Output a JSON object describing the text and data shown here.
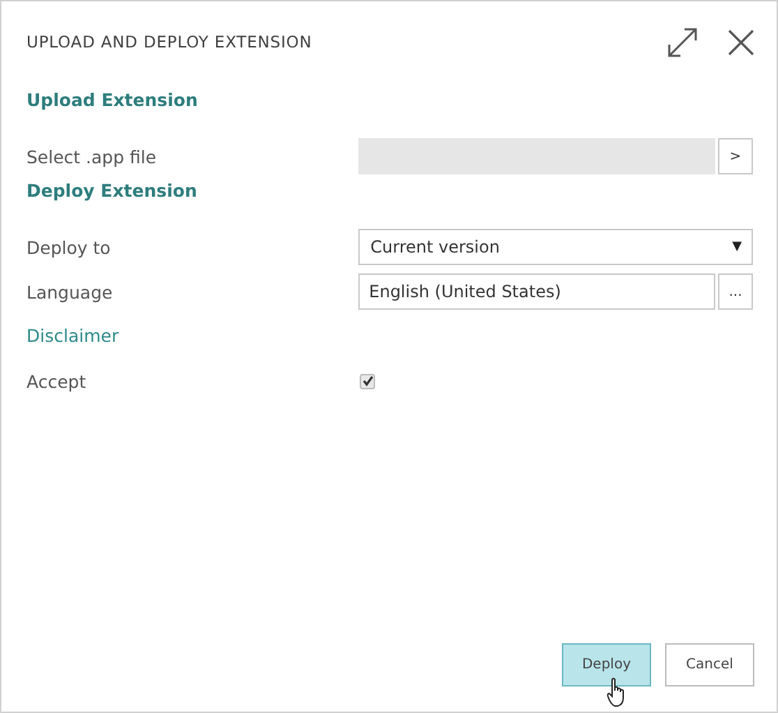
{
  "window": {
    "title": "UPLOAD AND DEPLOY EXTENSION"
  },
  "sections": [
    {
      "kind": "heading",
      "text": "Upload Extension"
    },
    {
      "kind": "file",
      "label": "Select .app file",
      "button": ">"
    },
    {
      "kind": "heading",
      "text": "Deploy Extension"
    },
    {
      "kind": "select",
      "label": "Deploy to",
      "value": "Current version",
      "arrow": "▼"
    },
    {
      "kind": "lookup",
      "label": "Language",
      "value": "English (United States)",
      "button": "..."
    },
    {
      "kind": "link",
      "text": "Disclaimer"
    },
    {
      "kind": "checkbox",
      "label": "Accept",
      "checked": true
    }
  ],
  "buttons": [
    {
      "label": "Deploy",
      "kind": "primary"
    },
    {
      "label": "Cancel",
      "kind": "secondary"
    }
  ]
}
